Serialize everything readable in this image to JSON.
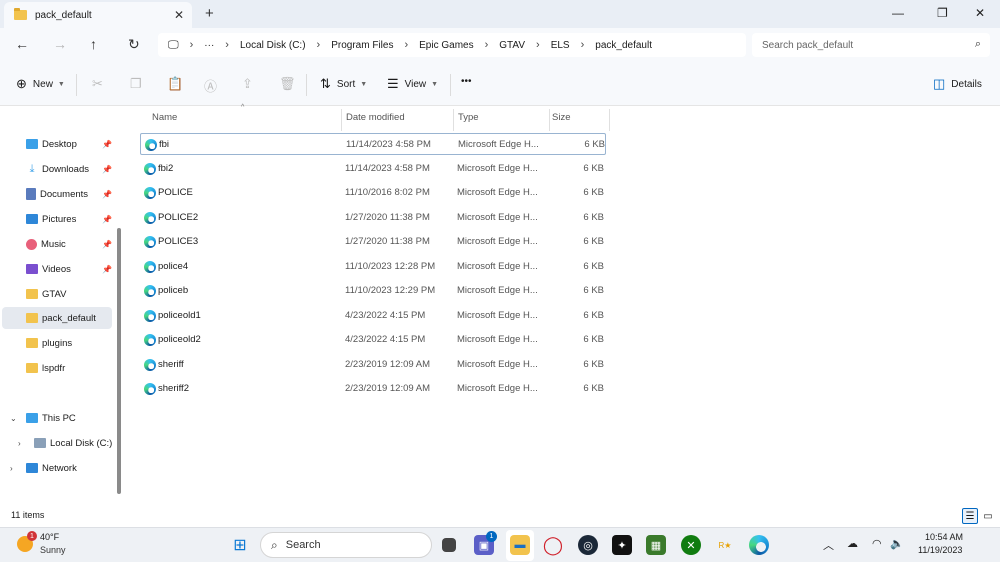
{
  "tab": {
    "title": "pack_default",
    "close": "✕",
    "new_tab": "+"
  },
  "window_controls": {
    "minimize": "—",
    "maximize": "❐",
    "close": "✕"
  },
  "address": {
    "crumbs": [
      "Local Disk (C:)",
      "Program Files",
      "Epic Games",
      "GTAV",
      "ELS",
      "pack_default"
    ],
    "more": "···",
    "search_placeholder": "Search pack_default"
  },
  "command_bar": {
    "new_label": "New",
    "sort_label": "Sort",
    "view_label": "View",
    "more_label": "•••",
    "details_label": "Details"
  },
  "sidebar": {
    "quick": [
      {
        "label": "Desktop",
        "icon": "desktop-icon",
        "color": "#3aa0e8",
        "pinned": true
      },
      {
        "label": "Downloads",
        "icon": "download-icon",
        "color": "#3aa0e8",
        "pinned": true
      },
      {
        "label": "Documents",
        "icon": "documents-icon",
        "color": "#5a7bbd",
        "pinned": true
      },
      {
        "label": "Pictures",
        "icon": "pictures-icon",
        "color": "#2e87d8",
        "pinned": true
      },
      {
        "label": "Music",
        "icon": "music-icon",
        "color": "#e8607a",
        "pinned": true
      },
      {
        "label": "Videos",
        "icon": "videos-icon",
        "color": "#7a4fcf",
        "pinned": true
      },
      {
        "label": "GTAV",
        "icon": "folder-icon",
        "color": "#f2c34d",
        "pinned": false
      },
      {
        "label": "pack_default",
        "icon": "folder-icon",
        "color": "#f2c34d",
        "pinned": false
      },
      {
        "label": "plugins",
        "icon": "folder-icon",
        "color": "#f2c34d",
        "pinned": false
      },
      {
        "label": "lspdfr",
        "icon": "folder-icon",
        "color": "#f2c34d",
        "pinned": false
      }
    ],
    "this_pc": "This PC",
    "local_disk": "Local Disk (C:)",
    "network": "Network"
  },
  "columns": {
    "name": "Name",
    "date": "Date modified",
    "type": "Type",
    "size": "Size"
  },
  "files": [
    {
      "name": "fbi",
      "date": "11/14/2023 4:58 PM",
      "type": "Microsoft Edge H...",
      "size": "6 KB"
    },
    {
      "name": "fbi2",
      "date": "11/14/2023 4:58 PM",
      "type": "Microsoft Edge H...",
      "size": "6 KB"
    },
    {
      "name": "POLICE",
      "date": "11/10/2016 8:02 PM",
      "type": "Microsoft Edge H...",
      "size": "6 KB"
    },
    {
      "name": "POLICE2",
      "date": "1/27/2020 11:38 PM",
      "type": "Microsoft Edge H...",
      "size": "6 KB"
    },
    {
      "name": "POLICE3",
      "date": "1/27/2020 11:38 PM",
      "type": "Microsoft Edge H...",
      "size": "6 KB"
    },
    {
      "name": "police4",
      "date": "11/10/2023 12:28 PM",
      "type": "Microsoft Edge H...",
      "size": "6 KB"
    },
    {
      "name": "policeb",
      "date": "11/10/2023 12:29 PM",
      "type": "Microsoft Edge H...",
      "size": "6 KB"
    },
    {
      "name": "policeold1",
      "date": "4/23/2022 4:15 PM",
      "type": "Microsoft Edge H...",
      "size": "6 KB"
    },
    {
      "name": "policeold2",
      "date": "4/23/2022 4:15 PM",
      "type": "Microsoft Edge H...",
      "size": "6 KB"
    },
    {
      "name": "sheriff",
      "date": "2/23/2019 12:09 AM",
      "type": "Microsoft Edge H...",
      "size": "6 KB"
    },
    {
      "name": "sheriff2",
      "date": "2/23/2019 12:09 AM",
      "type": "Microsoft Edge H...",
      "size": "6 KB"
    }
  ],
  "status": {
    "count": "11 items"
  },
  "taskbar": {
    "weather_temp": "40°F",
    "weather_cond": "Sunny",
    "weather_badge": "1",
    "search_label": "Search",
    "teams_badge": "1",
    "time": "10:54 AM",
    "date": "11/19/2023"
  }
}
